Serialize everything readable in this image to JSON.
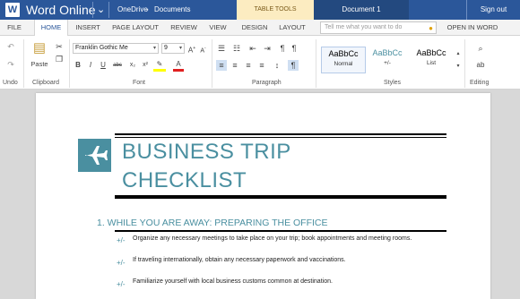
{
  "titlebar": {
    "logo_letter": "W",
    "app_name": "Word Online",
    "breadcrumb": [
      "OneDrive",
      "Documents"
    ],
    "contextual_tab": "TABLE TOOLS",
    "document_name": "Document 1",
    "sign_out": "Sign out",
    "brand_color": "#2b579a"
  },
  "tabs": {
    "items": [
      "FILE",
      "HOME",
      "INSERT",
      "PAGE LAYOUT",
      "REVIEW",
      "VIEW",
      "DESIGN",
      "LAYOUT",
      "OPEN IN WORD"
    ],
    "active": "HOME",
    "tell_me_placeholder": "Tell me what you want to do"
  },
  "ribbon": {
    "groups": [
      "Undo",
      "Clipboard",
      "Font",
      "Paragraph",
      "Styles",
      "Editing"
    ],
    "paste_label": "Paste",
    "font_name": "Franklin Gothic Me",
    "font_size": "9",
    "styles": [
      {
        "preview": "AaBbCc",
        "name": "Normal"
      },
      {
        "preview": "AaBbCc",
        "name": "+/-"
      },
      {
        "preview": "AaBbCc",
        "name": "List"
      }
    ],
    "format_buttons": [
      "B",
      "I",
      "U",
      "abc",
      "x₂",
      "x²"
    ]
  },
  "document": {
    "title_line1": "BUSINESS TRIP",
    "title_line2": "CHECKLIST",
    "heading": "1.  WHILE YOU ARE AWAY: PREPARING THE OFFICE",
    "marker": "+/-",
    "items": [
      "Organize any necessary meetings to take place on your trip; book appointments and meeting rooms.",
      "If traveling internationally, obtain any necessary paperwork and vaccinations.",
      "Familiarize yourself with local business customs common at destination."
    ],
    "accent_color": "#4a8fa0"
  }
}
